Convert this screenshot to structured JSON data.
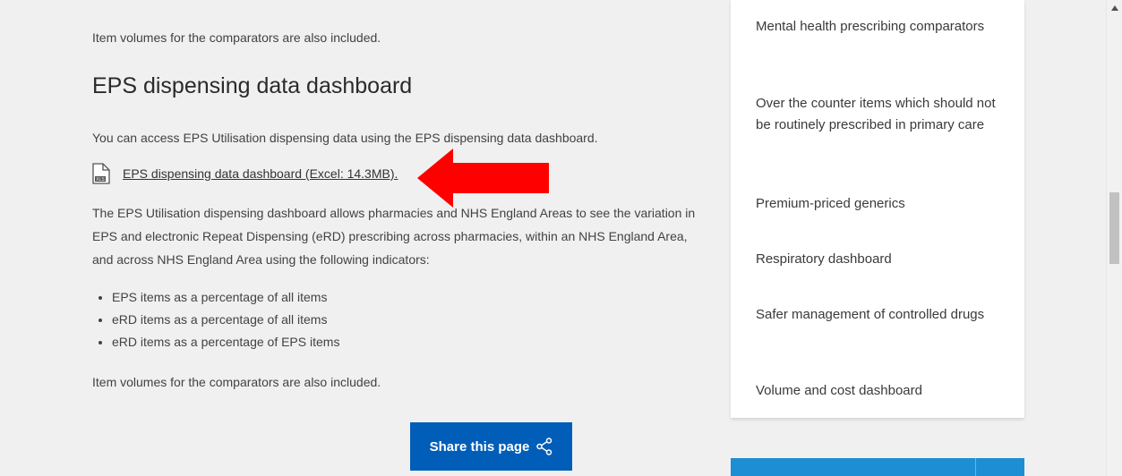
{
  "main": {
    "top_paragraph": "Item volumes for the comparators are also included.",
    "heading": "EPS dispensing data dashboard",
    "access_paragraph": "You can access EPS Utilisation dispensing data using the EPS dispensing data dashboard.",
    "file_link": {
      "label": "EPS dispensing data dashboard (Excel: 14.3MB).",
      "icon_badge": "XLS"
    },
    "description": "The EPS Utilisation dispensing dashboard allows pharmacies and NHS England Areas to see the variation in EPS and electronic Repeat Dispensing (eRD) prescribing across pharmacies, within an NHS England Area, and across NHS England Area using the following indicators:",
    "bullets": [
      "EPS items as a percentage of all items",
      "eRD items as a percentage of all items",
      "eRD items as a percentage of EPS items"
    ],
    "bottom_paragraph": "Item volumes for the comparators are also included.",
    "share_button": "Share this page"
  },
  "sidebar": {
    "items": [
      "Mental health prescribing comparators",
      "Over the counter items which should not be routinely prescribed in primary care",
      "Premium-priced generics",
      "Respiratory dashboard",
      "Safer management of controlled drugs",
      "Volume and cost dashboard"
    ]
  },
  "colors": {
    "page_background": "#f0f0f0",
    "share_button": "#005eb8",
    "annotation_arrow": "#ff0000",
    "blue_box": "#1d8ed3"
  },
  "icons": {
    "file": "excel-file-icon",
    "share": "share-icon",
    "annotation": "red-arrow-icon"
  }
}
